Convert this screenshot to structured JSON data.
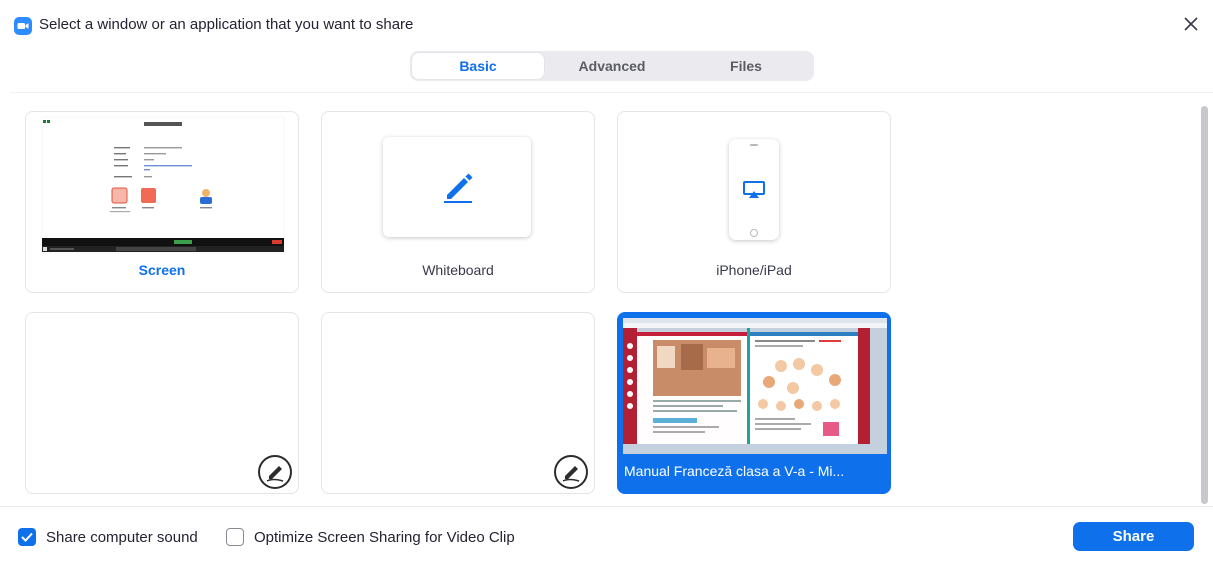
{
  "title": "Select a window or an application that you want to share",
  "tabs": [
    {
      "label": "Basic",
      "active": true
    },
    {
      "label": "Advanced",
      "active": false
    },
    {
      "label": "Files",
      "active": false
    }
  ],
  "cards": {
    "screen": {
      "label": "Screen"
    },
    "whiteboard": {
      "label": "Whiteboard"
    },
    "iphone": {
      "label": "iPhone/iPad"
    },
    "window1": {
      "label": ""
    },
    "window2": {
      "label": ""
    },
    "window3": {
      "label": "Manual Franceză clasa a V-a - Mi..."
    }
  },
  "footer": {
    "share_sound_label": "Share computer sound",
    "share_sound_checked": true,
    "optimize_label": "Optimize Screen Sharing for Video Clip",
    "optimize_checked": false,
    "share_button": "Share"
  },
  "colors": {
    "accent": "#0e71eb",
    "tab_bg": "#ebebef",
    "card_border": "#e4e4e8"
  },
  "icons": {
    "app": "zoom-camera-icon",
    "close": "close-icon",
    "whiteboard": "pen-icon",
    "iphone": "airplay-icon",
    "window_badge": "annotate-pen-icon"
  }
}
